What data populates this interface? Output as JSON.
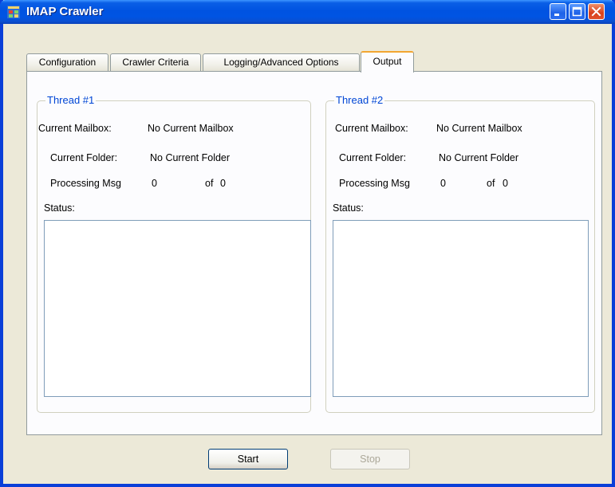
{
  "window": {
    "title": "IMAP Crawler",
    "icon": "app-window-icon",
    "controls": [
      "minimize-icon",
      "maximize-icon",
      "close-icon"
    ]
  },
  "tabs": [
    {
      "label": "Configuration",
      "active": false
    },
    {
      "label": "Crawler Criteria",
      "active": false
    },
    {
      "label": "Logging/Advanced Options",
      "active": false
    },
    {
      "label": "Output",
      "active": true
    }
  ],
  "threads": [
    {
      "title": "Thread #1",
      "mailbox_label": "Current Mailbox:",
      "mailbox_value": "No Current Mailbox",
      "folder_label": "Current Folder:",
      "folder_value": "No Current Folder",
      "processing_label": "Processing Msg",
      "processing_current": "0",
      "of_label": "of",
      "processing_total": "0",
      "status_label": "Status:",
      "status_text": ""
    },
    {
      "title": "Thread #2",
      "mailbox_label": "Current Mailbox:",
      "mailbox_value": "No Current Mailbox",
      "folder_label": "Current Folder:",
      "folder_value": "No Current Folder",
      "processing_label": "Processing Msg",
      "processing_current": "0",
      "of_label": "of",
      "processing_total": "0",
      "status_label": "Status:",
      "status_text": ""
    }
  ],
  "buttons": {
    "start": {
      "label": "Start",
      "enabled": true
    },
    "stop": {
      "label": "Stop",
      "enabled": false
    }
  },
  "colors": {
    "titlebar": "#0054e3",
    "group_title": "#0046d5",
    "active_tab_accent": "#f3a631"
  }
}
